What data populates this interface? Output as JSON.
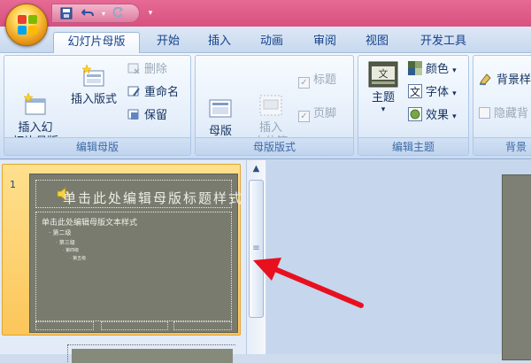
{
  "quick_access": {
    "items": [
      "save-icon",
      "undo-icon",
      "redo-icon"
    ],
    "more": "▾"
  },
  "tabs": [
    "幻灯片母版",
    "开始",
    "插入",
    "动画",
    "审阅",
    "视图",
    "开发工具"
  ],
  "ribbon": {
    "edit_master": {
      "label": "编辑母版",
      "insert_slide_master": "插入幻\n灯片母版",
      "insert_layout": "插入版式",
      "delete": "删除",
      "rename": "重命名",
      "preserve": "保留"
    },
    "master_layout": {
      "label": "母版版式",
      "master_layout_btn": "母版\n版式",
      "insert_placeholder": "插入\n占位符",
      "placeholder_more": "▾",
      "title": "标题",
      "footer": "页脚"
    },
    "edit_theme": {
      "label": "编辑主题",
      "themes": "主题",
      "themes_more": "▾",
      "colors": "颜色",
      "fonts": "字体",
      "effects": "效果",
      "dropdown": "▾"
    },
    "background": {
      "label": "背景",
      "background_styles": "背景样",
      "hide_bg": "隐藏背"
    }
  },
  "slides": {
    "number": "1",
    "title": "单击此处编辑母版标题样式",
    "body_levels": [
      "单击此处编辑母版文本样式",
      "· 第二级",
      "· 第三级",
      "· 第四级",
      "· 第五级"
    ]
  },
  "colors": {
    "titlebar": "#e0608b",
    "slide_bg": "#787b6e",
    "selection": "#fcc65a",
    "arrow": "#e8101e"
  }
}
